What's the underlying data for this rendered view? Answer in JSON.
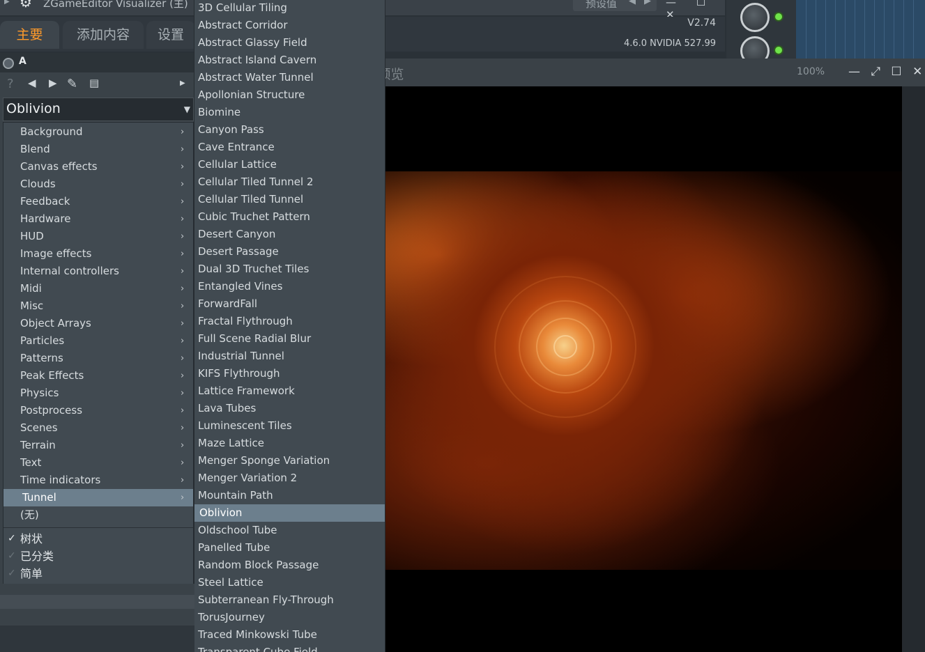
{
  "app": {
    "title": "ZGameEditor Visualizer (主)",
    "preset_box_label": "预设值",
    "window_buttons": "— ☐ ✕",
    "version": "V2.74",
    "gpu_info": "4.6.0 NVIDIA 527.99"
  },
  "tabs": [
    {
      "label": "主要"
    },
    {
      "label": "添加内容"
    },
    {
      "label": "设置"
    }
  ],
  "layer": {
    "label": "A"
  },
  "preset_selector": {
    "value": "Oblivion"
  },
  "categories": [
    {
      "label": "Background"
    },
    {
      "label": "Blend"
    },
    {
      "label": "Canvas effects"
    },
    {
      "label": "Clouds"
    },
    {
      "label": "Feedback"
    },
    {
      "label": "Hardware"
    },
    {
      "label": "HUD"
    },
    {
      "label": "Image effects"
    },
    {
      "label": "Internal controllers"
    },
    {
      "label": "Midi"
    },
    {
      "label": "Misc"
    },
    {
      "label": "Object Arrays"
    },
    {
      "label": "Particles"
    },
    {
      "label": "Patterns"
    },
    {
      "label": "Peak Effects"
    },
    {
      "label": "Physics"
    },
    {
      "label": "Postprocess"
    },
    {
      "label": "Scenes"
    },
    {
      "label": "Terrain"
    },
    {
      "label": "Text"
    },
    {
      "label": "Time indicators"
    },
    {
      "label": "Tunnel"
    }
  ],
  "selected_category": "Tunnel",
  "none_option": "(无)",
  "view_options": [
    {
      "label": "树状",
      "checked": true
    },
    {
      "label": "已分类",
      "checked": false
    },
    {
      "label": "简单",
      "checked": false
    }
  ],
  "presets": [
    "3D Cellular Tiling",
    "Abstract Corridor",
    "Abstract Glassy Field",
    "Abstract Island Cavern",
    "Abstract Water Tunnel",
    "Apollonian Structure",
    "Biomine",
    "Canyon Pass",
    "Cave Entrance",
    "Cellular Lattice",
    "Cellular Tiled Tunnel 2",
    "Cellular Tiled Tunnel",
    "Cubic Truchet Pattern",
    "Desert Canyon",
    "Desert Passage",
    "Dual 3D Truchet Tiles",
    "Entangled Vines",
    "ForwardFall",
    "Fractal Flythrough",
    "Full Scene Radial Blur",
    "Industrial Tunnel",
    "KIFS Flythrough",
    "Lattice Framework",
    "Lava Tubes",
    "Luminescent Tiles",
    "Maze Lattice",
    "Menger Sponge Variation",
    "Menger Variation 2",
    "Mountain Path",
    "Oblivion",
    "Oldschool Tube",
    "Panelled Tube",
    "Random Block Passage",
    "Steel Lattice",
    "Subterranean Fly-Through",
    "TorusJourney",
    "Traced Minkowski Tube",
    "Transparent Cube Field"
  ],
  "selected_preset": "Oblivion",
  "preview": {
    "title": "sualizer - 预览",
    "zoom": "100%"
  }
}
